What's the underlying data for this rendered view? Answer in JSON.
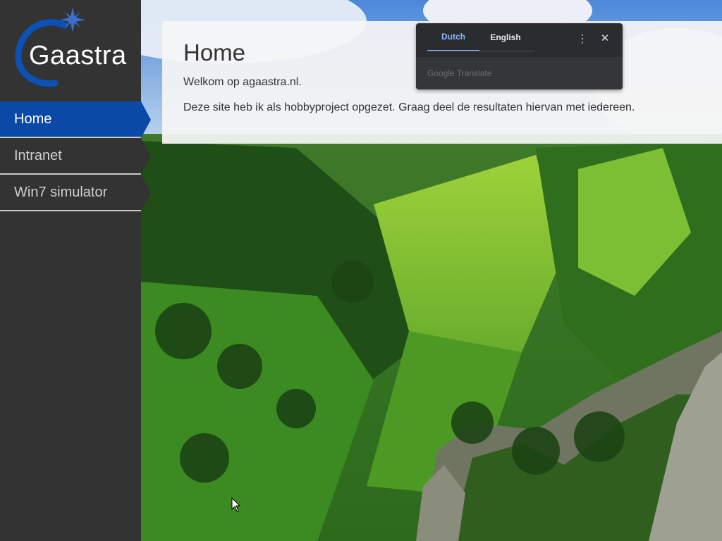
{
  "brand": {
    "name": "Gaastra"
  },
  "nav": {
    "items": [
      {
        "label": "Home",
        "active": true
      },
      {
        "label": "Intranet",
        "active": false
      },
      {
        "label": "Win7 simulator",
        "active": false
      }
    ]
  },
  "content": {
    "title": "Home",
    "intro": "Welkom op agaastra.nl.",
    "body": "Deze site heb ik als hobbyproject opgezet. Graag deel de resultaten hiervan met iedereen."
  },
  "translate": {
    "tabs": [
      "Dutch",
      "English"
    ],
    "active_tab": "Dutch",
    "brand": "Google Translate",
    "more_icon": "more-vert-icon",
    "close_icon": "close-icon"
  },
  "colors": {
    "sidebar": "#333333",
    "active_nav": "#0a4aa6",
    "accent_blue": "#8ab4f8"
  }
}
